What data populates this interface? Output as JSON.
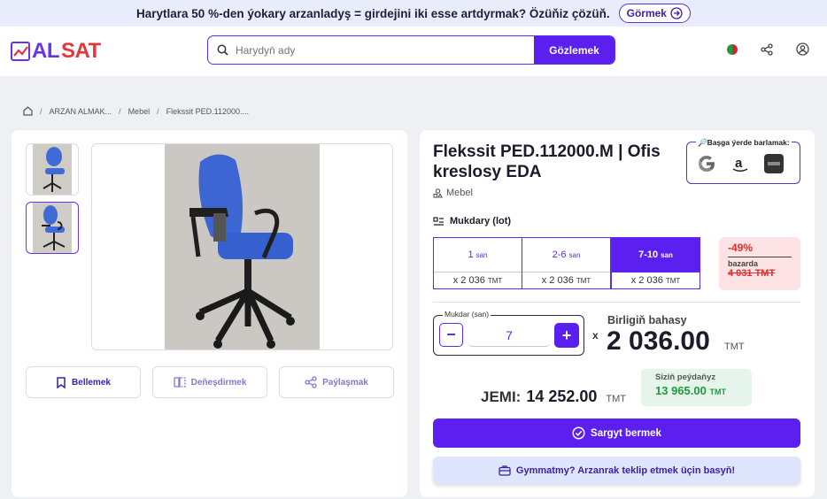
{
  "promo": {
    "text": "Harytlara 50 %-den ýokary arzanladyş = girdejini iki esse artdyrmak? Özüňiz çözüň.",
    "button": "Görmek"
  },
  "header": {
    "logo_a": "AL",
    "logo_b": "SAT",
    "search_placeholder": "Harydyň ady",
    "search_button": "Gözlemek",
    "icons": [
      "flag-icon",
      "share-icon",
      "user-icon"
    ]
  },
  "breadcrumb": {
    "items": [
      "ARZAN ALMAK...",
      "Mebel",
      "Flekssit PED.112000...."
    ]
  },
  "gallery": {
    "actions": {
      "save": "Bellemek",
      "compare": "Deňeşdirmek",
      "share": "Paýlaşmak"
    }
  },
  "product": {
    "title": "Flekssit PED.112000.M | Ofis kreslosy EDA",
    "category": "Mebel",
    "search_elsewhere": "Başga ýerde barlamak:",
    "quantity_label": "Mukdary (lot)",
    "tiers": [
      {
        "range": "1",
        "unit": "san",
        "price": "x 2 036",
        "cur": "TMT"
      },
      {
        "range": "2-6",
        "unit": "san",
        "price": "x 2 036",
        "cur": "TMT"
      },
      {
        "range": "7-10",
        "unit": "san",
        "price": "x 2 036",
        "cur": "TMT"
      }
    ],
    "discount": {
      "pct": "-49%",
      "label": "bazarda",
      "old_price": "4 031 TMT"
    },
    "qty_label": "Mukdar (san)",
    "qty_value": "7",
    "unit_price_label": "Birligiň bahasy",
    "unit_price": "2 036.00",
    "currency": "TMT",
    "total_label": "JEMI:",
    "total": "14 252.00",
    "savings_label": "Siziň peýdaňyz",
    "savings_value": "13 965.00",
    "order_button": "Sargyt bermek",
    "offer_button": "Gymmatmy? Arzanrak teklip etmek üçin basyň!"
  },
  "colors": {
    "accent": "#5b1ff0",
    "brand_red": "#e6363c",
    "savings_green": "#1f9a3c"
  }
}
